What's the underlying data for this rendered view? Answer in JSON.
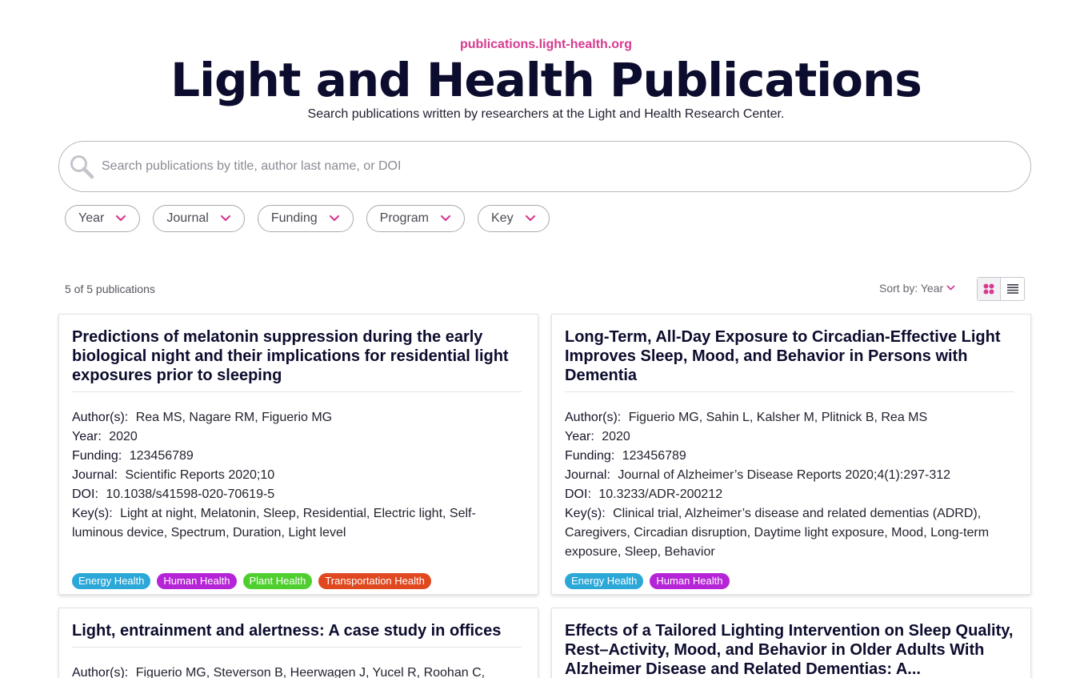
{
  "header": {
    "url": "publications.light-health.org",
    "title": "Light and Health Publications",
    "subtitle": "Search publications written by researchers at the Light and Health Research Center."
  },
  "search": {
    "placeholder": "Search publications by title, author last name, or DOI",
    "icon": "search-icon"
  },
  "filters": [
    {
      "label": "Year"
    },
    {
      "label": "Journal"
    },
    {
      "label": "Funding"
    },
    {
      "label": "Program"
    },
    {
      "label": "Key"
    }
  ],
  "results": {
    "count_text": "5 of 5 publications",
    "sort_label": "Sort by: Year",
    "view_modes": [
      "grid-view-icon",
      "list-view-icon"
    ],
    "active_view": "grid"
  },
  "labels": {
    "authors": "Author(s):",
    "year": "Year:",
    "funding": "Funding:",
    "journal": "Journal:",
    "doi": "DOI:",
    "keys": "Key(s):"
  },
  "colors": {
    "accent": "#d63b8f",
    "energy_health": "#2ba8d8",
    "human_health": "#b524d6",
    "plant_health": "#4fcf2f",
    "transportation_health": "#e0481f"
  },
  "publications": [
    {
      "title": "Predictions of melatonin suppression during the early biological night and their implications for residential light exposures prior to sleeping",
      "authors": "Rea MS, Nagare RM, Figuerio MG",
      "year": "2020",
      "funding": "123456789",
      "journal": "Scientific Reports 2020;10",
      "doi": "10.1038/s41598-020-70619-5",
      "keys": "Light at night, Melatonin, Sleep, Residential, Electric light, Self-luminous device, Spectrum, Duration, Light level",
      "tags": [
        "Energy Health",
        "Human Health",
        "Plant Health",
        "Transportation Health"
      ]
    },
    {
      "title": "Long-Term, All-Day Exposure to Circadian-Effective Light Improves Sleep, Mood, and Behavior in Persons with Dementia",
      "authors": "Figuerio MG, Sahin L, Kalsher M, Plitnick B, Rea MS",
      "year": "2020",
      "funding": "123456789",
      "journal": "Journal of Alzheimer’s Disease Reports 2020;4(1):297-312",
      "doi": "10.3233/ADR-200212",
      "keys_line1": "Clinical trial, Alzheimer’s disease and related dementias (ADRD),",
      "keys_line2": "Caregivers, Circadian disruption, Daytime light exposure, Mood, Long-term",
      "keys_line3": "exposure, Sleep, Behavior",
      "tags": [
        "Energy Health",
        "Human Health"
      ]
    },
    {
      "title": "Light, entrainment and alertness: A case study in offices",
      "authors": "Figuerio MG, Steverson B, Heerwagen J, Yucel R, Roohan C,"
    },
    {
      "title": "Effects of a Tailored Lighting Intervention on Sleep Quality, Rest–Activity, Mood, and Behavior in Older Adults With Alzheimer Disease and Related Dementias: A..."
    }
  ]
}
